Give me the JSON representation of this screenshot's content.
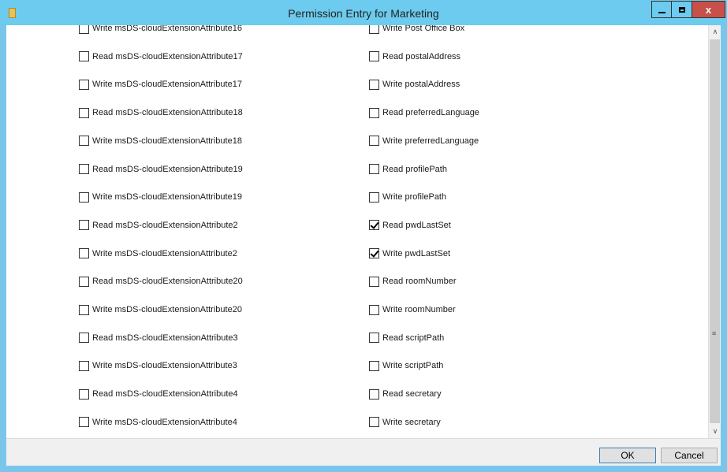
{
  "window": {
    "title": "Permission Entry for Marketing",
    "close_glyph": "x",
    "icons": [
      "folder-icon",
      "minimize-icon",
      "maximize-icon",
      "close-icon"
    ]
  },
  "permissions": {
    "left": [
      {
        "label": "Write msDS-cloudExtensionAttribute16",
        "checked": false
      },
      {
        "label": "Read msDS-cloudExtensionAttribute17",
        "checked": false
      },
      {
        "label": "Write msDS-cloudExtensionAttribute17",
        "checked": false
      },
      {
        "label": "Read msDS-cloudExtensionAttribute18",
        "checked": false
      },
      {
        "label": "Write msDS-cloudExtensionAttribute18",
        "checked": false
      },
      {
        "label": "Read msDS-cloudExtensionAttribute19",
        "checked": false
      },
      {
        "label": "Write msDS-cloudExtensionAttribute19",
        "checked": false
      },
      {
        "label": "Read msDS-cloudExtensionAttribute2",
        "checked": false
      },
      {
        "label": "Write msDS-cloudExtensionAttribute2",
        "checked": false
      },
      {
        "label": "Read msDS-cloudExtensionAttribute20",
        "checked": false
      },
      {
        "label": "Write msDS-cloudExtensionAttribute20",
        "checked": false
      },
      {
        "label": "Read msDS-cloudExtensionAttribute3",
        "checked": false
      },
      {
        "label": "Write msDS-cloudExtensionAttribute3",
        "checked": false
      },
      {
        "label": "Read msDS-cloudExtensionAttribute4",
        "checked": false
      },
      {
        "label": "Write msDS-cloudExtensionAttribute4",
        "checked": false
      }
    ],
    "right": [
      {
        "label": "Write Post Office Box",
        "checked": false
      },
      {
        "label": "Read postalAddress",
        "checked": false
      },
      {
        "label": "Write postalAddress",
        "checked": false
      },
      {
        "label": "Read preferredLanguage",
        "checked": false
      },
      {
        "label": "Write preferredLanguage",
        "checked": false
      },
      {
        "label": "Read profilePath",
        "checked": false
      },
      {
        "label": "Write profilePath",
        "checked": false
      },
      {
        "label": "Read pwdLastSet",
        "checked": true
      },
      {
        "label": "Write pwdLastSet",
        "checked": true
      },
      {
        "label": "Read roomNumber",
        "checked": false
      },
      {
        "label": "Write roomNumber",
        "checked": false
      },
      {
        "label": "Read scriptPath",
        "checked": false
      },
      {
        "label": "Write scriptPath",
        "checked": false
      },
      {
        "label": "Read secretary",
        "checked": false
      },
      {
        "label": "Write secretary",
        "checked": false
      }
    ]
  },
  "buttons": {
    "ok": "OK",
    "cancel": "Cancel"
  },
  "colors": {
    "titlebar": "#6ccbee",
    "close": "#c7514a"
  }
}
